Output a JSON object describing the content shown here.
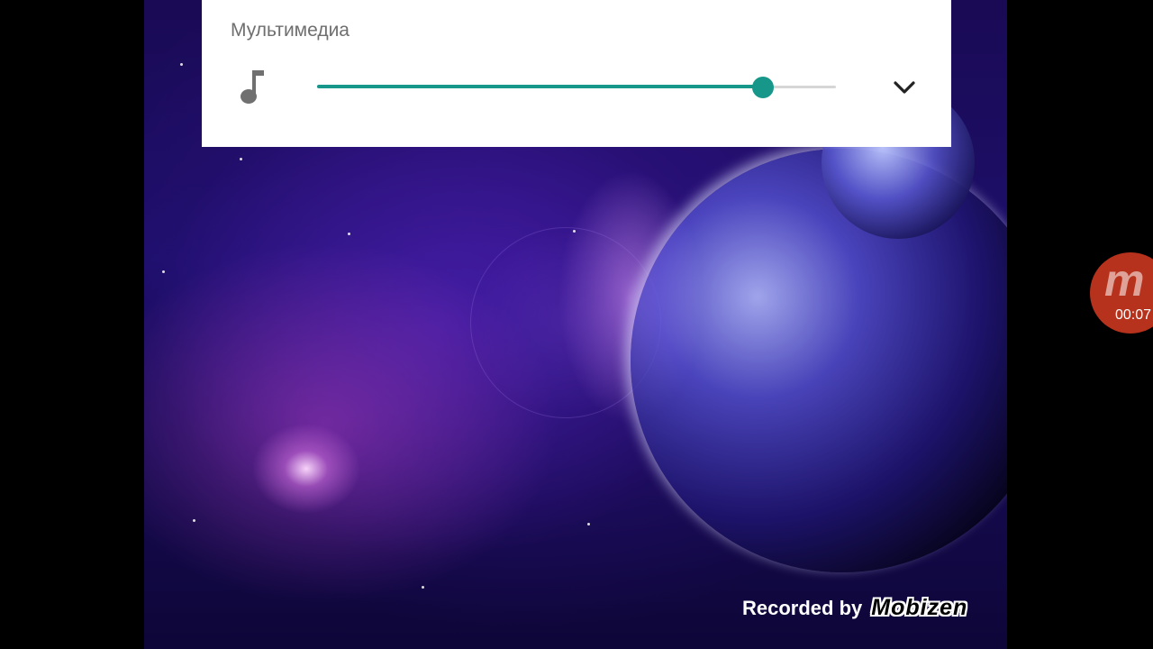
{
  "volume_panel": {
    "title": "Мультимедиа",
    "stream_icon": "music-note-icon",
    "volume_fraction": 0.86,
    "expand_icon": "chevron-down-icon",
    "accent_color": "#16978a",
    "track_color": "#d6d6d6"
  },
  "recorder": {
    "logo": "m",
    "elapsed": "00:07",
    "color": "#b7321d"
  },
  "watermark": {
    "text": "Recorded by",
    "brand": "Mobizen"
  }
}
